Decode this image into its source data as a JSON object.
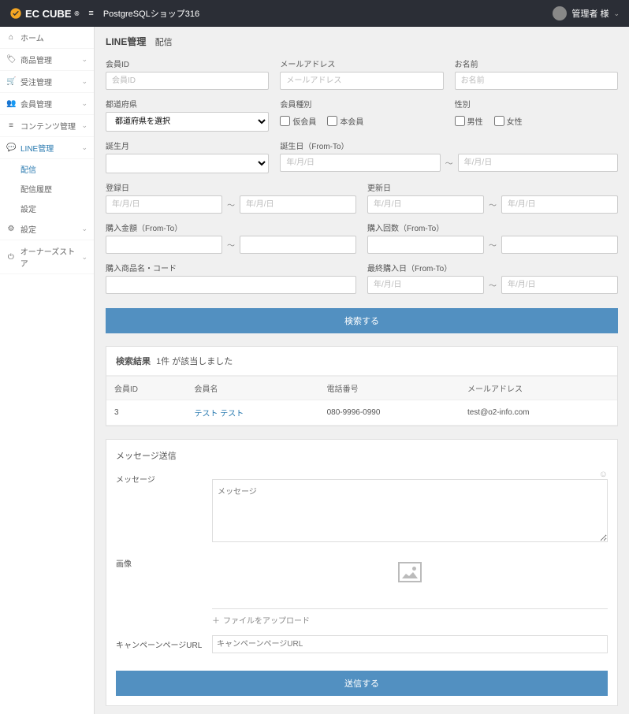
{
  "header": {
    "logo": "EC CUBE",
    "shopName": "PostgreSQLショップ316",
    "userName": "管理者 様"
  },
  "sidebar": {
    "items": [
      {
        "label": "ホーム",
        "icon": "home"
      },
      {
        "label": "商品管理",
        "icon": "tag"
      },
      {
        "label": "受注管理",
        "icon": "cart"
      },
      {
        "label": "会員管理",
        "icon": "users"
      },
      {
        "label": "コンテンツ管理",
        "icon": "list"
      },
      {
        "label": "LINE管理",
        "icon": "comment"
      },
      {
        "label": "設定",
        "icon": "gear"
      },
      {
        "label": "オーナーズストア",
        "icon": "power"
      }
    ],
    "subs": [
      {
        "label": "配信"
      },
      {
        "label": "配信履歴"
      },
      {
        "label": "設定"
      }
    ]
  },
  "page": {
    "title": "LINE管理",
    "sub": "配信"
  },
  "form": {
    "memberId": {
      "label": "会員ID",
      "placeholder": "会員ID"
    },
    "email": {
      "label": "メールアドレス",
      "placeholder": "メールアドレス"
    },
    "name": {
      "label": "お名前",
      "placeholder": "お名前"
    },
    "pref": {
      "label": "都道府県",
      "placeholder": "都道府県を選択"
    },
    "memberType": {
      "label": "会員種別",
      "opt1": "仮会員",
      "opt2": "本会員"
    },
    "sex": {
      "label": "性別",
      "opt1": "男性",
      "opt2": "女性"
    },
    "birthMonth": {
      "label": "誕生月"
    },
    "birthDate": {
      "label": "誕生日（From-To）",
      "placeholder": "年/月/日"
    },
    "regDate": {
      "label": "登録日",
      "placeholder": "年/月/日"
    },
    "updateDate": {
      "label": "更新日",
      "placeholder": "年/月/日"
    },
    "purchaseAmount": {
      "label": "購入金額（From-To）"
    },
    "purchaseCount": {
      "label": "購入回数（From-To）"
    },
    "productCode": {
      "label": "購入商品名・コード"
    },
    "lastPurchase": {
      "label": "最終購入日（From-To）",
      "placeholder": "年/月/日"
    },
    "searchBtn": "検索する"
  },
  "results": {
    "label": "検索結果",
    "countText": "1件 が該当しました",
    "cols": {
      "id": "会員ID",
      "name": "会員名",
      "tel": "電話番号",
      "email": "メールアドレス"
    },
    "rows": [
      {
        "id": "3",
        "name": "テスト テスト",
        "tel": "080-9996-0990",
        "email": "test@o2-info.com"
      }
    ]
  },
  "message": {
    "title": "メッセージ送信",
    "msgLabel": "メッセージ",
    "msgPlaceholder": "メッセージ",
    "imgLabel": "画像",
    "uploadText": "ファイルをアップロード",
    "urlLabel": "キャンペーンページURL",
    "urlPlaceholder": "キャンペーンページURL",
    "sendBtn": "送信する"
  }
}
